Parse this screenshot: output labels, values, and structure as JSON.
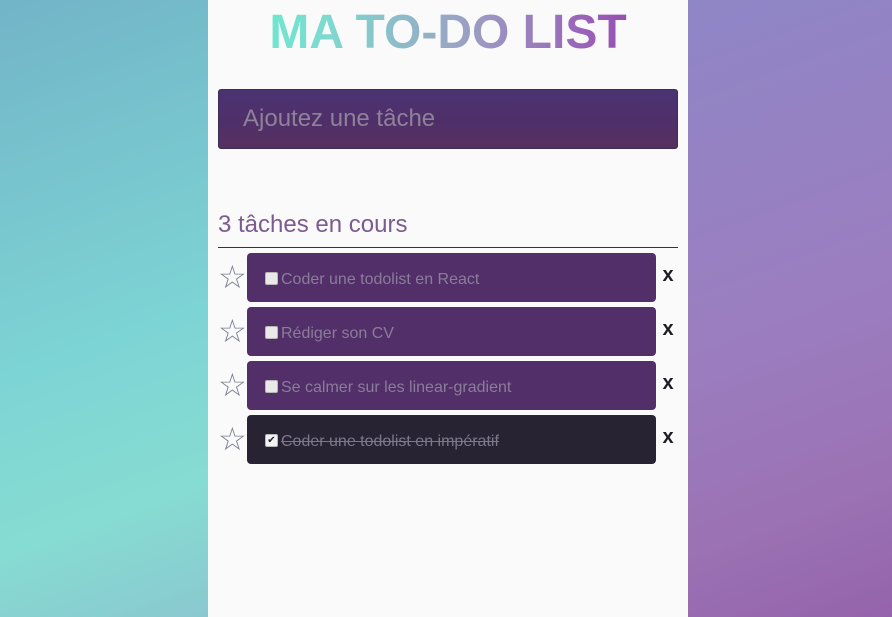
{
  "header": {
    "title": "MA TO-DO LIST"
  },
  "task_input": {
    "placeholder": "Ajoutez une tâche",
    "value": ""
  },
  "summary": {
    "count_text": "3 tâches en cours"
  },
  "tasks": [
    {
      "label": "Coder une todolist en React",
      "done": false,
      "starred": false,
      "star_icon": "☆",
      "check_glyph": "",
      "delete_label": "x"
    },
    {
      "label": "Rédiger son CV",
      "done": false,
      "starred": false,
      "star_icon": "☆",
      "check_glyph": "",
      "delete_label": "x"
    },
    {
      "label": "Se calmer sur les linear-gradient",
      "done": false,
      "starred": false,
      "star_icon": "☆",
      "check_glyph": "",
      "delete_label": "x"
    },
    {
      "label": "Coder une todolist en impératif",
      "done": true,
      "starred": false,
      "star_icon": "☆",
      "check_glyph": "✔",
      "delete_label": "x"
    }
  ],
  "colors": {
    "task_card": "#532f69",
    "task_card_done": "#272333",
    "input_background": "#4f2f6a",
    "count_text": "#7c5b8e"
  }
}
